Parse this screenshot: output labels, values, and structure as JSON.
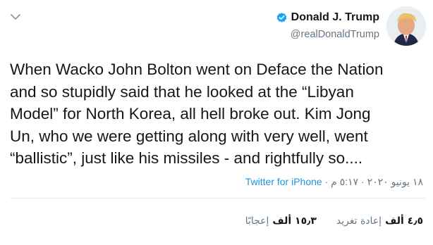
{
  "user": {
    "display_name": "Donald J. Trump",
    "handle": "@realDonaldTrump",
    "verified": true
  },
  "tweet": {
    "text": "When Wacko John Bolton went on Deface the Nation\nand so stupidly said that he looked at the “Libyan\nModel” for North Korea, all hell broke out. Kim Jong\nUn, who we were getting along with very well, went\n“ballistic”, just like his missiles - and rightfully so....",
    "time": "٥:١٧ م",
    "separator": " · ",
    "date": "١٨ يونيو ٢٠٢٠",
    "source": "Twitter for iPhone"
  },
  "stats": {
    "retweets_value": "٤٫٥ ألف",
    "retweets_label": "إعادة تغريد",
    "likes_value": "١٥٫٣ ألف",
    "likes_label": "إعجابًا"
  },
  "icons": {
    "chevron": "chevron-down-icon",
    "verified": "verified-badge-icon"
  },
  "colors": {
    "verified_blue": "#1da1f2",
    "link_blue": "#1b95e0",
    "secondary_text": "#657786",
    "primary_text": "#14171a",
    "divider": "#e6ecf0"
  }
}
